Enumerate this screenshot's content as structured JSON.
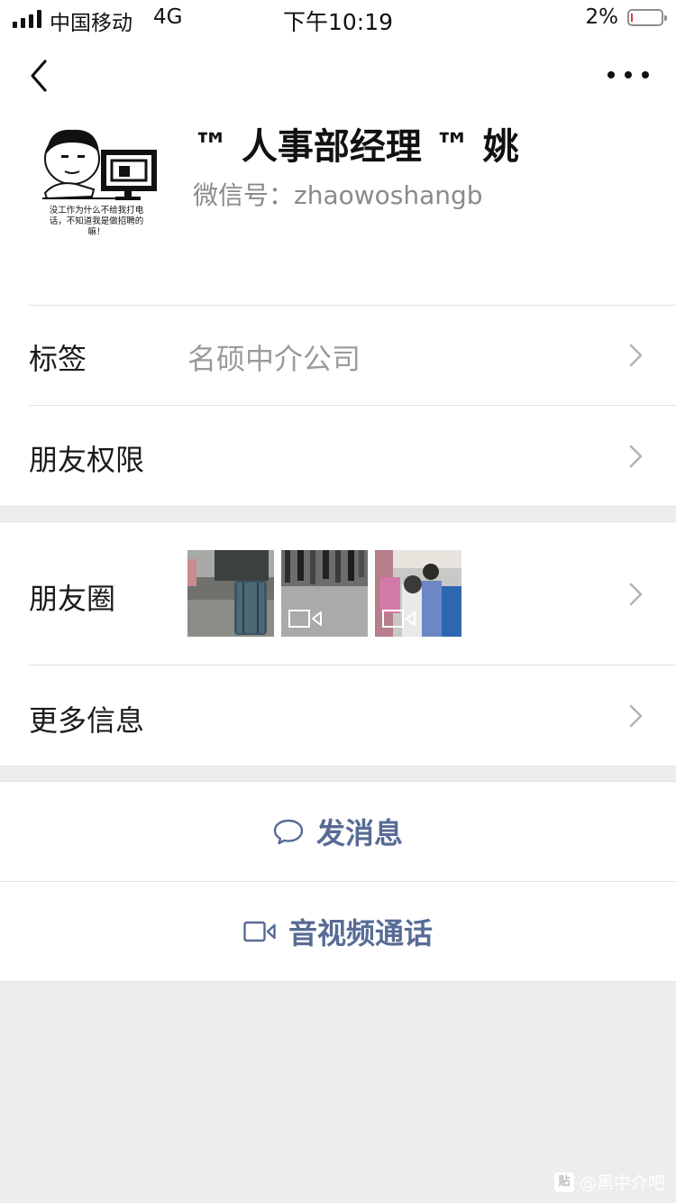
{
  "status_bar": {
    "carrier": "中国移动",
    "network": "4G",
    "time": "下午10:19",
    "battery_percent": "2%",
    "battery_level": 0.02
  },
  "profile": {
    "name": "™ 人事部经理 ™ 姚",
    "wechat_id": "微信号：zhaowoshangb",
    "avatar_caption_line1": "没工作为什么不给我打电",
    "avatar_caption_line2": "话，不知道我是做招聘的",
    "avatar_caption_line3": "嘛！"
  },
  "rows": {
    "tags_label": "标签",
    "tags_value": "名硕中介公司",
    "permissions_label": "朋友权限",
    "moments_label": "朋友圈",
    "more_info_label": "更多信息"
  },
  "actions": {
    "send_message": "发消息",
    "av_call": "音视频通话"
  },
  "watermark": {
    "badge": "贴",
    "text": "@黑中介吧"
  },
  "colors": {
    "link": "#576b95",
    "background": "#ededed",
    "battery_low": "#e5322d"
  }
}
